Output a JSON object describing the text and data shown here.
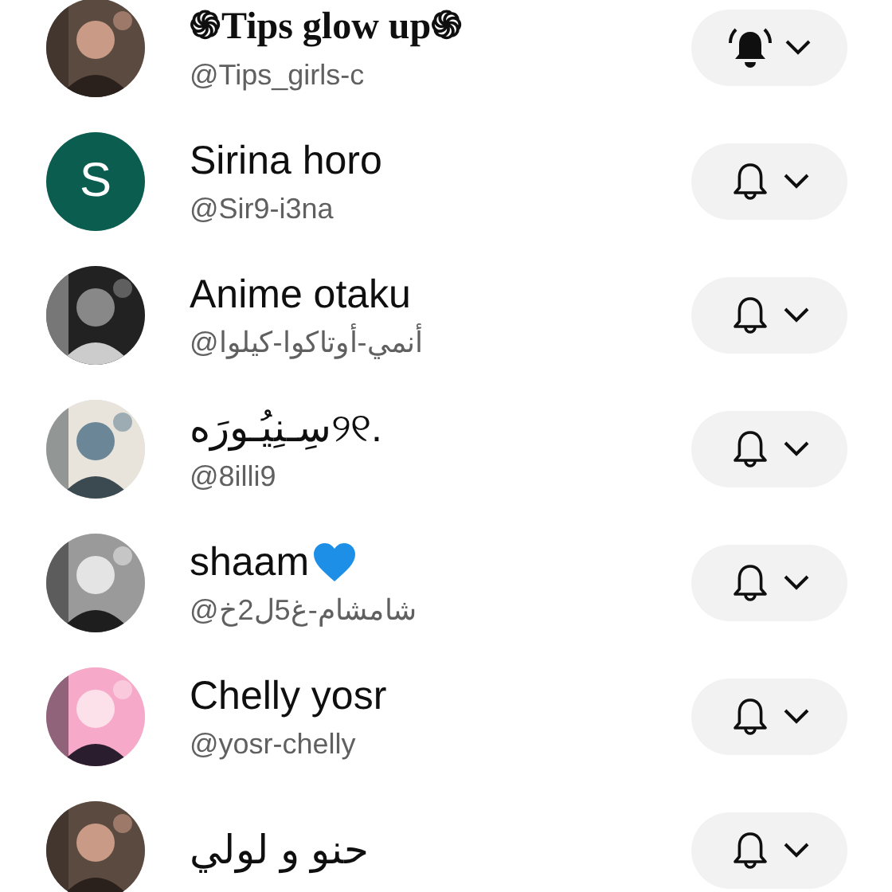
{
  "channels": [
    {
      "name": "֍Tips glow up֍",
      "handle": "@Tips_girls-c",
      "serif_bold": true,
      "heart_icon": false,
      "notify_all": true
    },
    {
      "name": "Sirina horo",
      "handle": "@Sir9-i3na",
      "avatar": {
        "kind": "letter",
        "letter": "S",
        "color": "#0b5e4f"
      },
      "serif_bold": false,
      "heart_icon": false,
      "notify_all": false
    },
    {
      "name": "Anime otaku",
      "handle": "@أنمي-أوتاكوا-كيلوا",
      "serif_bold": false,
      "heart_icon": false,
      "notify_all": false
    },
    {
      "name": "سِـنِيُـورَه୨୧.",
      "handle": "@8illi9",
      "serif_bold": false,
      "heart_icon": false,
      "notify_all": false
    },
    {
      "name": "shaam",
      "handle": "@شامشام-غ5ل2خ",
      "serif_bold": false,
      "heart_icon": true,
      "notify_all": false
    },
    {
      "name": "Chelly yosr",
      "handle": "@yosr-chelly",
      "serif_bold": false,
      "heart_icon": false,
      "notify_all": false
    },
    {
      "name": "حنو و لولي",
      "serif_bold": false,
      "heart_icon": false,
      "notify_all": false
    }
  ]
}
